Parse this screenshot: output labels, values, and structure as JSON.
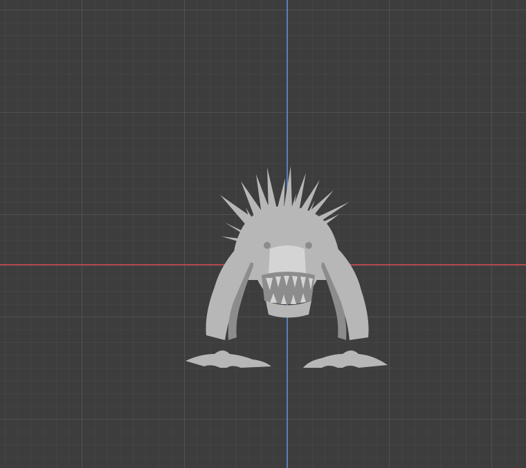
{
  "viewport": {
    "background_color": "#3d3d3d",
    "x_axis_color": "#b5484f",
    "y_axis_color": "#5a7fb8",
    "model_color": "#b7b7b7",
    "model_shadow_color": "#8c8c8c",
    "model_highlight_color": "#d4d4d4"
  }
}
